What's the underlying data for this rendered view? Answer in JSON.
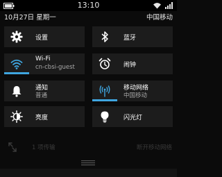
{
  "status": {
    "time": "13:10"
  },
  "info": {
    "date": "10月27日 星期一",
    "carrier": "中国移动"
  },
  "tiles": [
    {
      "id": "settings",
      "label": "设置",
      "icon": "gear-icon",
      "active": false
    },
    {
      "id": "bluetooth",
      "label": "蓝牙",
      "icon": "bluetooth-icon",
      "active": false
    },
    {
      "id": "wifi",
      "label": "Wi-Fi",
      "sub": "cn-cbsi-guest",
      "icon": "wifi-icon",
      "active": true
    },
    {
      "id": "alarm",
      "label": "闹钟",
      "icon": "alarm-clock-icon",
      "active": false
    },
    {
      "id": "notifications",
      "label": "通知",
      "sub": "普通",
      "icon": "bell-icon",
      "active": false
    },
    {
      "id": "mobile-network",
      "label": "移动网络",
      "sub": "中国移动",
      "icon": "antenna-icon",
      "active": true
    },
    {
      "id": "brightness",
      "label": "亮度",
      "icon": "brightness-icon",
      "active": false
    },
    {
      "id": "flashlight",
      "label": "闪光灯",
      "icon": "lightbulb-icon",
      "active": false
    }
  ],
  "disabled_row": {
    "label": "1 项传输",
    "right": "断开移动网络"
  },
  "colors": {
    "accent": "#3fa6e0",
    "tile_bg": "#1c1c1c",
    "background": "#0b0b0b"
  }
}
